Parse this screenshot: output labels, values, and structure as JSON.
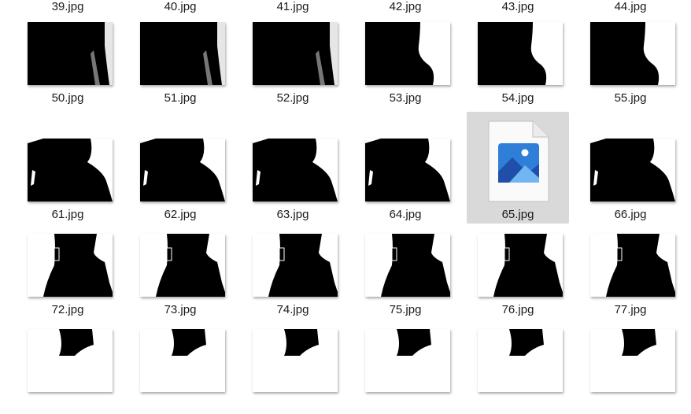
{
  "rows": [
    {
      "files": [
        {
          "name": "39.jpg",
          "shape": "none"
        },
        {
          "name": "40.jpg",
          "shape": "none"
        },
        {
          "name": "41.jpg",
          "shape": "none"
        },
        {
          "name": "42.jpg",
          "shape": "none"
        },
        {
          "name": "43.jpg",
          "shape": "none"
        },
        {
          "name": "44.jpg",
          "shape": "none"
        }
      ]
    },
    {
      "files": [
        {
          "name": "50.jpg",
          "shape": "a"
        },
        {
          "name": "51.jpg",
          "shape": "a"
        },
        {
          "name": "52.jpg",
          "shape": "a"
        },
        {
          "name": "53.jpg",
          "shape": "b"
        },
        {
          "name": "54.jpg",
          "shape": "b"
        },
        {
          "name": "55.jpg",
          "shape": "b"
        }
      ]
    },
    {
      "files": [
        {
          "name": "61.jpg",
          "shape": "c"
        },
        {
          "name": "62.jpg",
          "shape": "c"
        },
        {
          "name": "63.jpg",
          "shape": "c"
        },
        {
          "name": "64.jpg",
          "shape": "c"
        },
        {
          "name": "65.jpg",
          "shape": "icon",
          "selected": true
        },
        {
          "name": "66.jpg",
          "shape": "c"
        }
      ]
    },
    {
      "files": [
        {
          "name": "72.jpg",
          "shape": "d"
        },
        {
          "name": "73.jpg",
          "shape": "d"
        },
        {
          "name": "74.jpg",
          "shape": "d"
        },
        {
          "name": "75.jpg",
          "shape": "d"
        },
        {
          "name": "76.jpg",
          "shape": "d"
        },
        {
          "name": "77.jpg",
          "shape": "d"
        }
      ]
    },
    {
      "files": [
        {
          "name": "",
          "shape": "e"
        },
        {
          "name": "",
          "shape": "e"
        },
        {
          "name": "",
          "shape": "e"
        },
        {
          "name": "",
          "shape": "e"
        },
        {
          "name": "",
          "shape": "e"
        },
        {
          "name": "",
          "shape": "e"
        }
      ]
    }
  ],
  "icons": {
    "image_file": "image-file-icon"
  },
  "colors": {
    "selection": "#d9d9d9",
    "silhouette": "#000000",
    "photo_blue": "#2f7fd8"
  }
}
